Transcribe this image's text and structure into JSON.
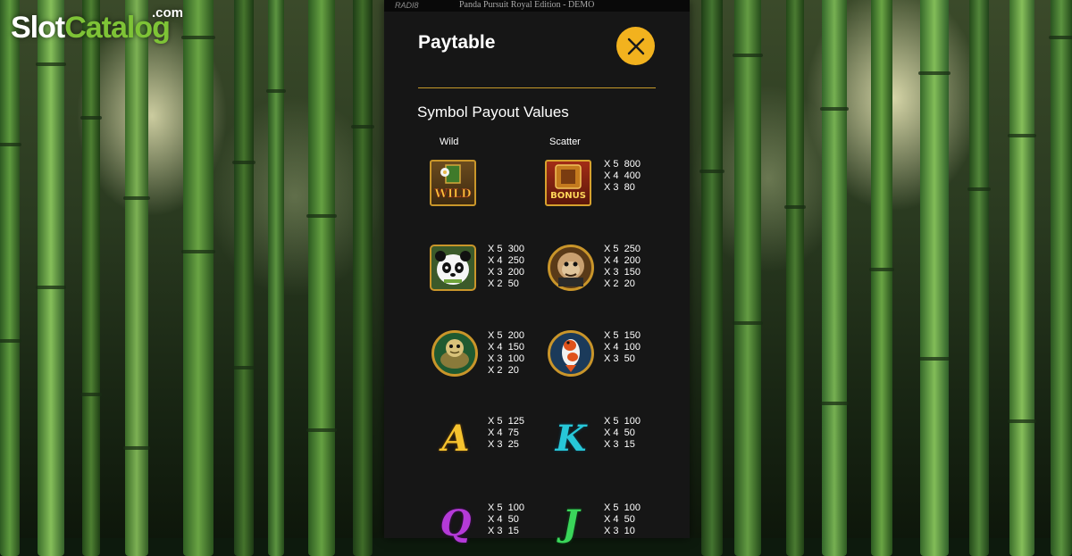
{
  "watermark": {
    "part1": "Slot",
    "part2": "Catalog",
    "suffix": ".com"
  },
  "titlebar": {
    "brand": "RADI8",
    "game_title": "Panda Pursuit Royal Edition - DEMO"
  },
  "paytable": {
    "title": "Paytable",
    "section_title": "Symbol Payout Values",
    "wild_label": "Wild",
    "scatter_label": "Scatter",
    "symbols": [
      {
        "id": "wild",
        "icon": "wild-icon",
        "caption": "WILD",
        "pays": ""
      },
      {
        "id": "scatter",
        "icon": "bonus-icon",
        "caption": "BONUS",
        "pays": "X 5  800\nX 4  400\nX 3  80"
      },
      {
        "id": "panda",
        "icon": "panda-icon",
        "pays": "X 5  300\nX 4  250\nX 3  200\nX 2  50"
      },
      {
        "id": "monkey",
        "icon": "monkey-icon",
        "pays": "X 5  250\nX 4  200\nX 3  150\nX 2  20"
      },
      {
        "id": "turtle",
        "icon": "turtle-icon",
        "pays": "X 5  200\nX 4  150\nX 3  100\nX 2  20"
      },
      {
        "id": "koi",
        "icon": "koi-fish-icon",
        "pays": "X 5  150\nX 4  100\nX 3  50"
      },
      {
        "id": "a",
        "icon": "letter-a-icon",
        "glyph": "A",
        "pays": "X 5  125\nX 4  75\nX 3  25"
      },
      {
        "id": "k",
        "icon": "letter-k-icon",
        "glyph": "K",
        "pays": "X 5  100\nX 4  50\nX 3  15"
      },
      {
        "id": "q",
        "icon": "letter-q-icon",
        "glyph": "Q",
        "pays": "X 5  100\nX 4  50\nX 3  15"
      },
      {
        "id": "j",
        "icon": "letter-j-icon",
        "glyph": "J",
        "pays": "X 5  100\nX 4  50\nX 3  10"
      }
    ]
  },
  "colors": {
    "accent": "#f2b21e",
    "panel": "#161616",
    "rule": "#c79a2a"
  }
}
